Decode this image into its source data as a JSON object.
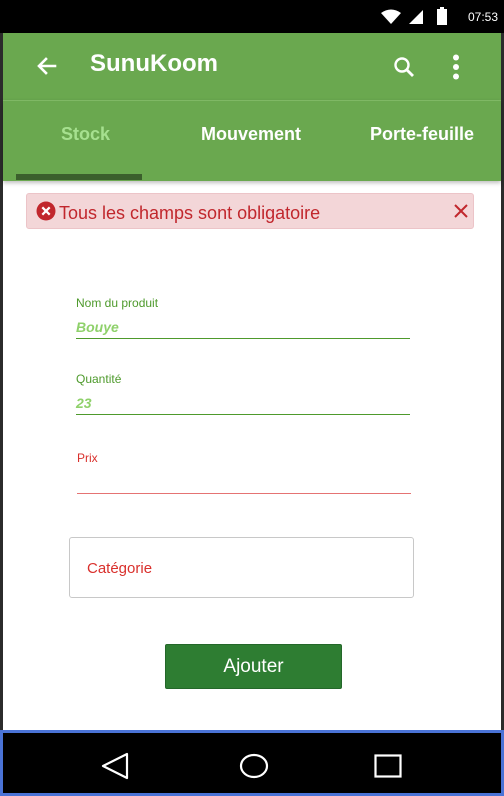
{
  "status_bar": {
    "time": "07:53",
    "icons": [
      "wifi-icon",
      "signal-icon",
      "battery-icon"
    ]
  },
  "app_bar": {
    "title": "SunuKoom",
    "icons": [
      "arrow-back-icon",
      "search-icon",
      "more-vert-icon"
    ]
  },
  "tabs": [
    {
      "label": "Stock",
      "active": true
    },
    {
      "label": "Mouvement",
      "active": false
    },
    {
      "label": "Porte-feuille",
      "active": false
    }
  ],
  "alert": {
    "message": "Tous les champs sont obligatoire",
    "icon": "error-circle-icon",
    "close_icon": "close-icon"
  },
  "form": {
    "name_label": "Nom du produit",
    "name_value": "Bouye",
    "quantity_label": "Quantité",
    "quantity_value": "23",
    "price_label": "Prix",
    "price_value": "",
    "category_label": "Catégorie",
    "submit_label": "Ajouter"
  },
  "nav_bar": {
    "icons": [
      "back-triangle-icon",
      "home-circle-icon",
      "recents-square-icon"
    ]
  },
  "colors": {
    "primary": "#6aa84f",
    "active_tab": "#a6e08f",
    "tab_indicator": "#3b5f2c",
    "error": "#c1272d",
    "alert_bg": "#f3d6d8",
    "button": "#2e7d32",
    "field_green": "#4e9a2c"
  }
}
